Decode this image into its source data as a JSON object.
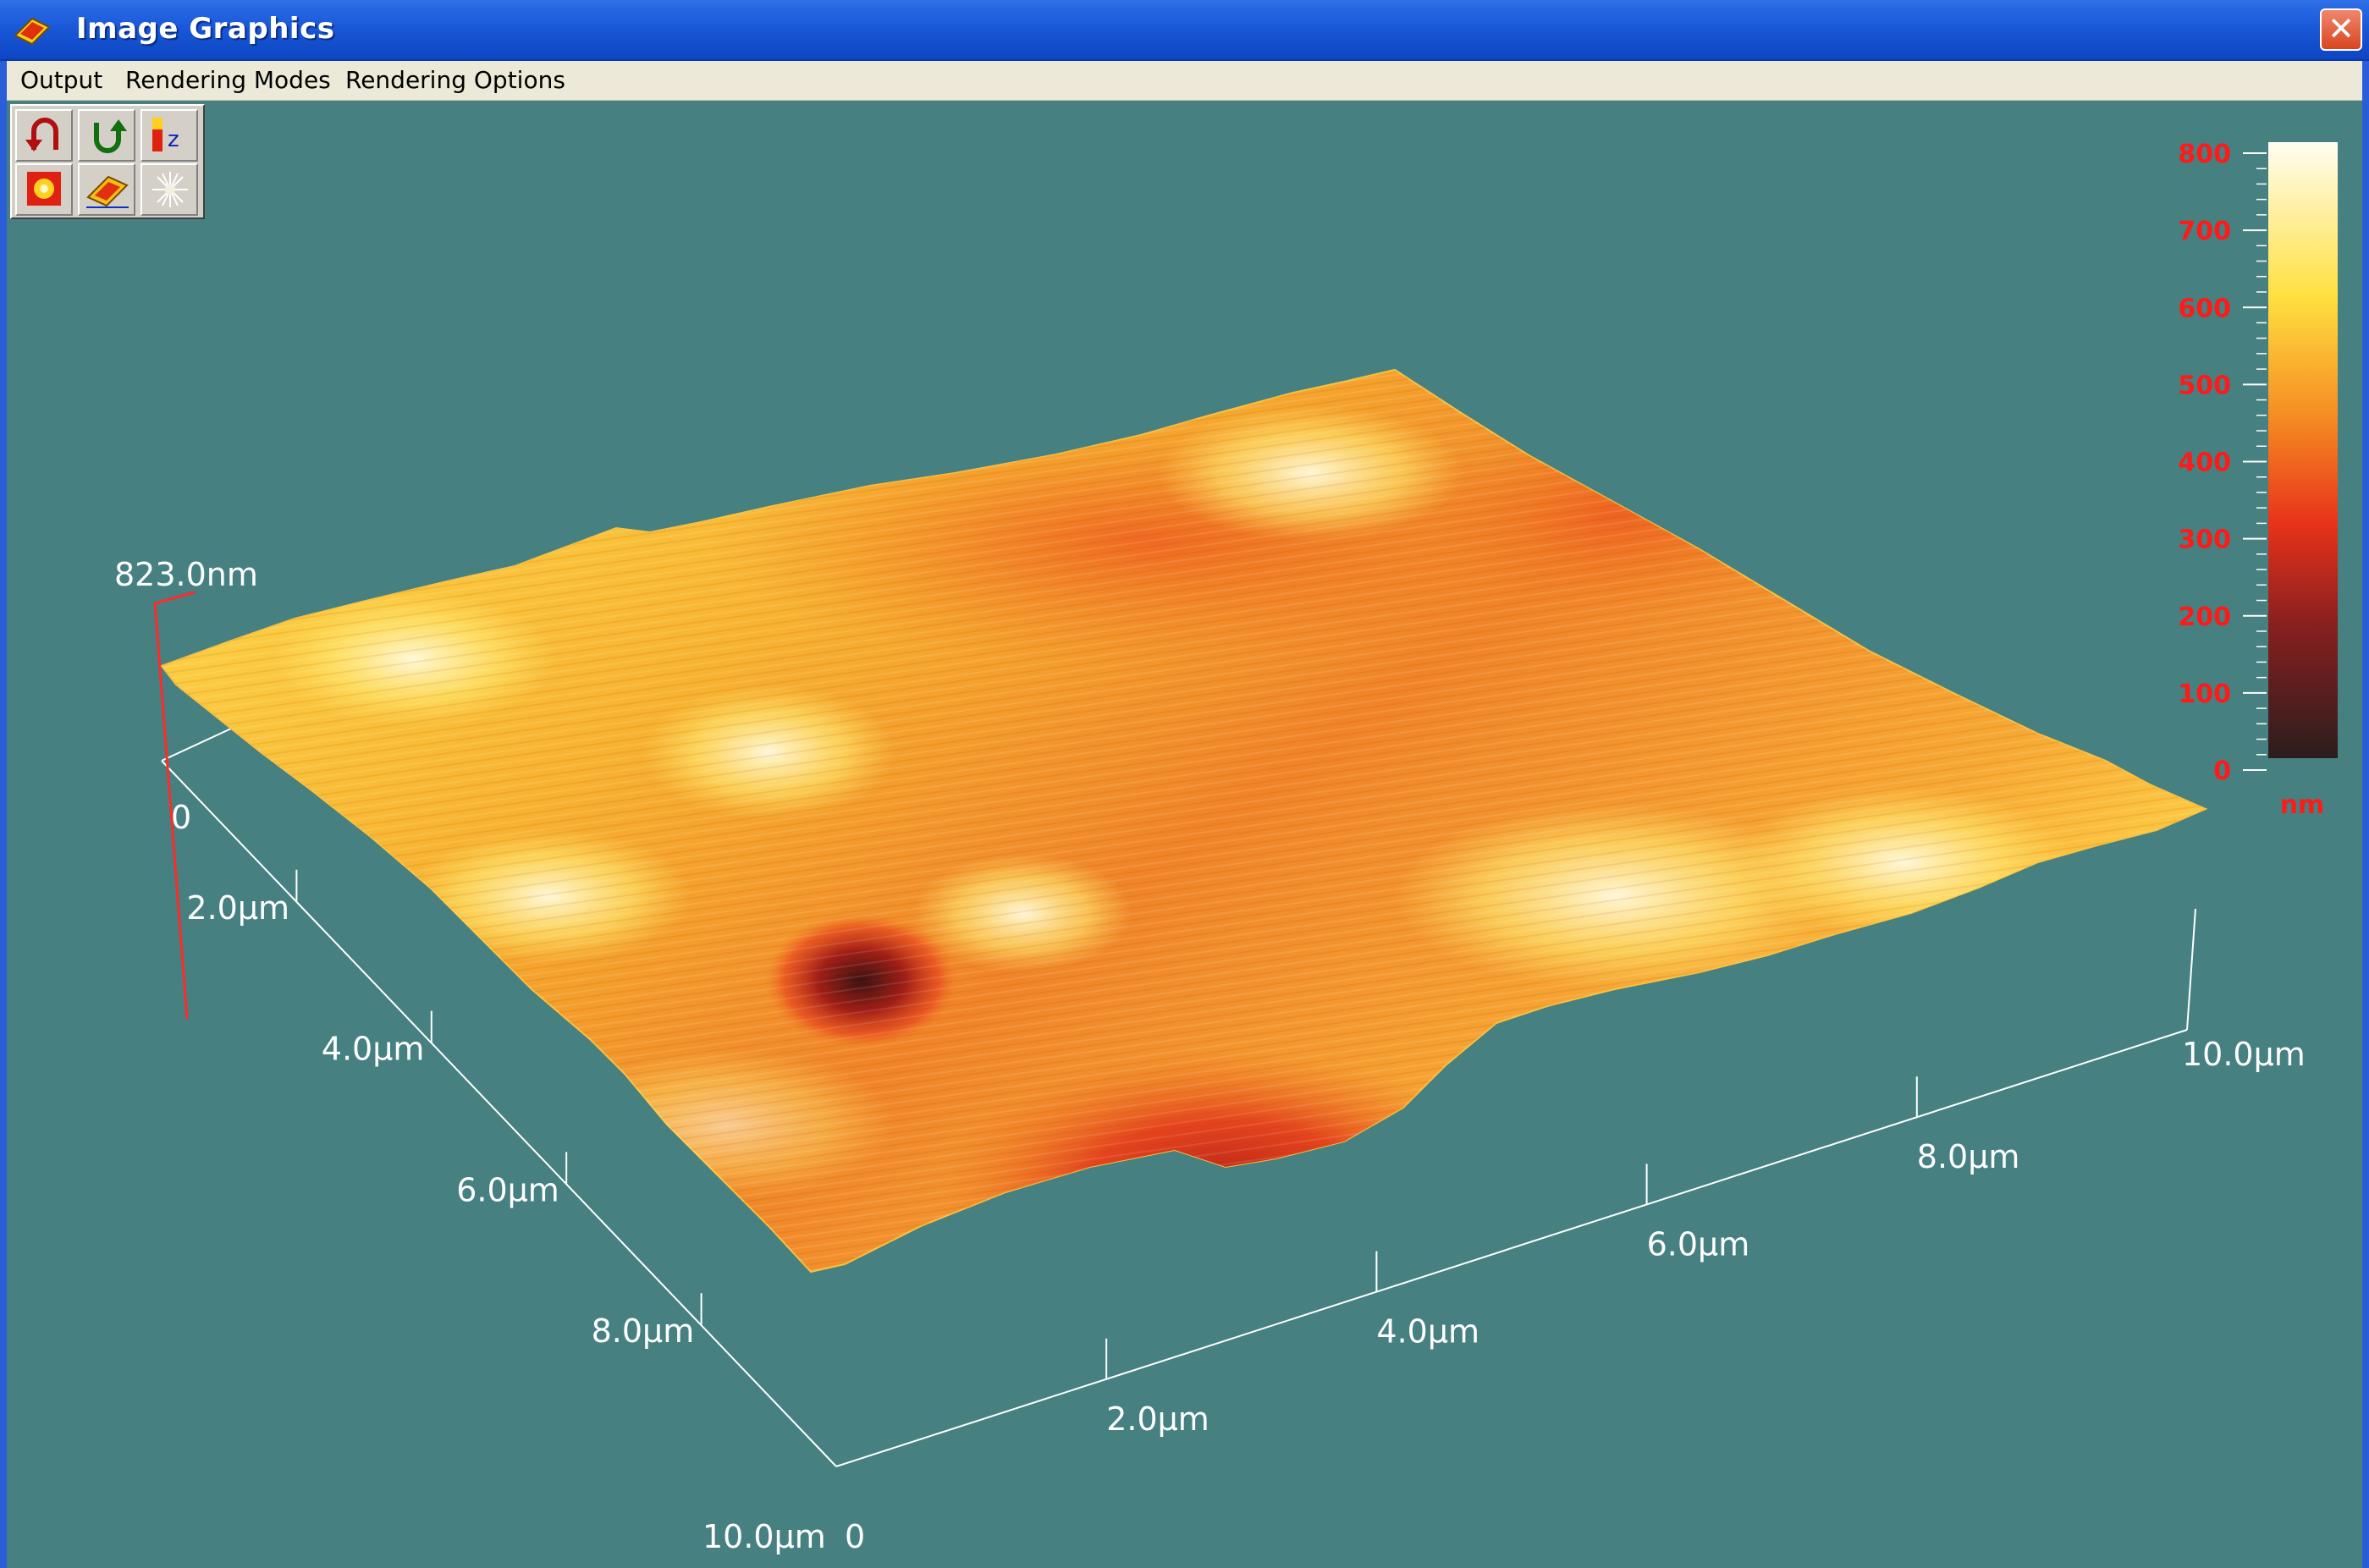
{
  "window": {
    "title": "Image Graphics",
    "close_glyph": "✕"
  },
  "menu": [
    {
      "label": "Output"
    },
    {
      "label": "Rendering Modes"
    },
    {
      "label": "Rendering Options"
    }
  ],
  "toolbar": {
    "buttons": [
      {
        "icon": "rotate-left-icon"
      },
      {
        "icon": "rotate-right-icon"
      },
      {
        "icon": "z-scale-icon"
      },
      {
        "icon": "color-map-icon"
      },
      {
        "icon": "surface-render-icon"
      },
      {
        "icon": "light-source-icon"
      }
    ]
  },
  "plot": {
    "z_max_label": "823.0nm",
    "x_axis": {
      "ticks": [
        {
          "value": 2,
          "label": "2.0µm"
        },
        {
          "value": 4,
          "label": "4.0µm"
        },
        {
          "value": 6,
          "label": "6.0µm"
        },
        {
          "value": 8,
          "label": "8.0µm"
        },
        {
          "value": 10,
          "label": "10.0µm"
        }
      ],
      "origin_label": "0"
    },
    "y_axis": {
      "origin_label": "0",
      "ticks": [
        {
          "value": 2,
          "label": "2.0µm"
        },
        {
          "value": 4,
          "label": "4.0µm"
        },
        {
          "value": 6,
          "label": "6.0µm"
        },
        {
          "value": 8,
          "label": "8.0µm"
        },
        {
          "value": 10,
          "label": "10.0µm"
        }
      ]
    },
    "colorbar": {
      "unit": "nm",
      "ticks": [
        800,
        700,
        600,
        500,
        400,
        300,
        200,
        100,
        0
      ],
      "min": 0,
      "max": 800,
      "label_color": "#ff1a1a"
    },
    "colors": {
      "background": "#468080",
      "surface_low": "#2b1d1d",
      "surface_mid": "#e8461e",
      "surface_high": "#fff7c8"
    }
  }
}
